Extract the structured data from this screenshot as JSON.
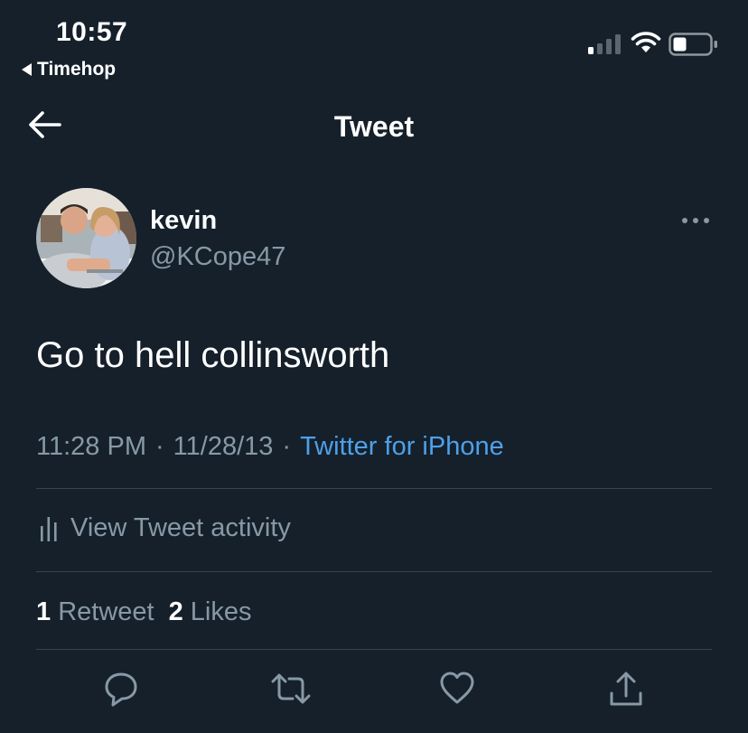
{
  "status_bar": {
    "time": "10:57",
    "back_app": "Timehop"
  },
  "nav": {
    "title": "Tweet",
    "back_icon": "arrow-left-icon"
  },
  "tweet": {
    "display_name": "kevin",
    "handle": "@KCope47",
    "text": "Go to hell collinsworth",
    "time": "11:28 PM",
    "date": "11/28/13",
    "source": "Twitter for iPhone",
    "separator": "·"
  },
  "activity": {
    "label": "View Tweet activity",
    "icon": "bar-chart-icon"
  },
  "stats": {
    "retweets_count": "1",
    "retweets_label": "Retweet",
    "likes_count": "2",
    "likes_label": "Likes"
  },
  "actions": [
    "reply-icon",
    "retweet-icon",
    "like-icon",
    "share-icon"
  ],
  "colors": {
    "background": "#15202b",
    "text": "#ffffff",
    "secondary_text": "#8899a6",
    "link": "#4ea0e8",
    "divider": "#38444d"
  }
}
